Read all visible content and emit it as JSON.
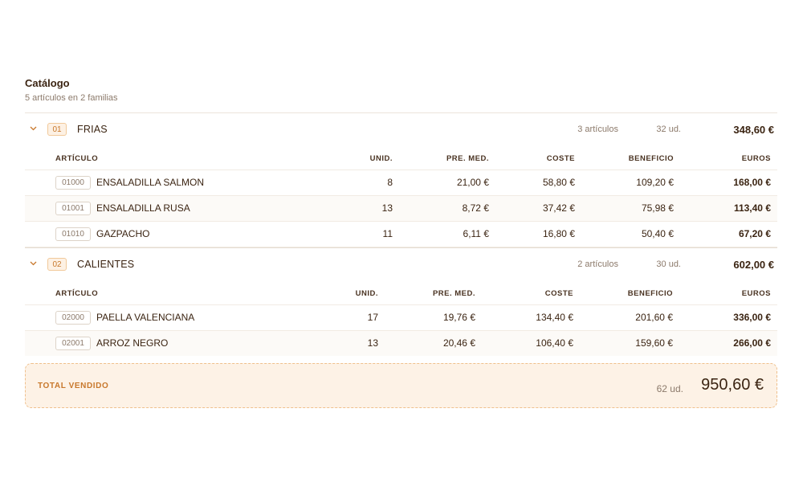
{
  "header": {
    "title": "Catálogo",
    "subtitle": "5 artículos en 2 familias"
  },
  "families": [
    {
      "code": "01",
      "name": "FRIAS",
      "count": "3 artículos",
      "units": "32 ud.",
      "total": "348,60 €",
      "columns": [
        "ARTÍCULO",
        "UNID.",
        "PRE. MED.",
        "COSTE",
        "BENEFICIO",
        "EUROS"
      ],
      "rows": [
        {
          "code": "01000",
          "name": "ENSALADILLA SALMON",
          "units": "8",
          "avg_price": "21,00 €",
          "cost": "58,80 €",
          "profit": "109,20 €",
          "euros": "168,00 €"
        },
        {
          "code": "01001",
          "name": "ENSALADILLA RUSA",
          "units": "13",
          "avg_price": "8,72 €",
          "cost": "37,42 €",
          "profit": "75,98 €",
          "euros": "113,40 €"
        },
        {
          "code": "01010",
          "name": "GAZPACHO",
          "units": "11",
          "avg_price": "6,11 €",
          "cost": "16,80 €",
          "profit": "50,40 €",
          "euros": "67,20 €"
        }
      ]
    },
    {
      "code": "02",
      "name": "CALIENTES",
      "count": "2 artículos",
      "units": "30 ud.",
      "total": "602,00 €",
      "columns": [
        "ARTÍCULO",
        "UNID.",
        "PRE. MED.",
        "COSTE",
        "BENEFICIO",
        "EUROS"
      ],
      "rows": [
        {
          "code": "02000",
          "name": "PAELLA VALENCIANA",
          "units": "17",
          "avg_price": "19,76 €",
          "cost": "134,40 €",
          "profit": "201,60 €",
          "euros": "336,00 €"
        },
        {
          "code": "02001",
          "name": "ARROZ NEGRO",
          "units": "13",
          "avg_price": "20,46 €",
          "cost": "106,40 €",
          "profit": "159,60 €",
          "euros": "266,00 €"
        }
      ]
    }
  ],
  "summary": {
    "label": "TOTAL VENDIDO",
    "units": "62 ud.",
    "total": "950,60 €"
  },
  "icons": {
    "collapse": "chevron-down-icon"
  },
  "colors": {
    "accent": "#c8782c",
    "accent_bg": "#fdf2e6",
    "text": "#3b2412",
    "muted": "#8c7a6b"
  }
}
